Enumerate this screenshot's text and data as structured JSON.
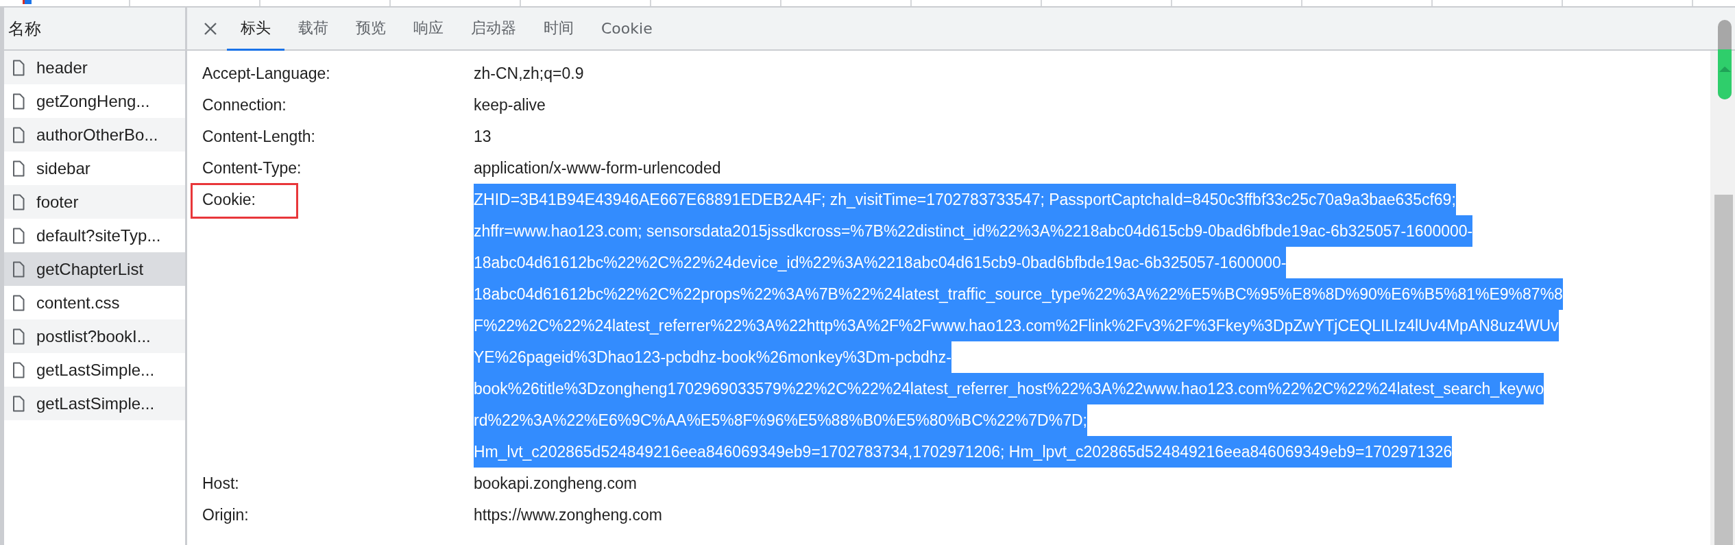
{
  "sidebar": {
    "title": "名称",
    "items": [
      {
        "label": "header",
        "selected": false
      },
      {
        "label": "getZongHeng...",
        "selected": false
      },
      {
        "label": "authorOtherBo...",
        "selected": false
      },
      {
        "label": "sidebar",
        "selected": false
      },
      {
        "label": "footer",
        "selected": false
      },
      {
        "label": "default?siteTyp...",
        "selected": false
      },
      {
        "label": "getChapterList",
        "selected": true
      },
      {
        "label": "content.css",
        "selected": false
      },
      {
        "label": "postlist?bookI...",
        "selected": false
      },
      {
        "label": "getLastSimple...",
        "selected": false
      },
      {
        "label": "getLastSimple...",
        "selected": false
      }
    ]
  },
  "tabs": [
    {
      "label": "标头",
      "selected": true
    },
    {
      "label": "载荷",
      "selected": false
    },
    {
      "label": "预览",
      "selected": false
    },
    {
      "label": "响应",
      "selected": false
    },
    {
      "label": "启动器",
      "selected": false
    },
    {
      "label": "时间",
      "selected": false
    },
    {
      "label": "Cookie",
      "selected": false
    }
  ],
  "headers": [
    {
      "name": "Accept-Language:",
      "value_lines": [
        "zh-CN,zh;q=0.9"
      ],
      "highlighted": false,
      "annotated": false
    },
    {
      "name": "Connection:",
      "value_lines": [
        "keep-alive"
      ],
      "highlighted": false,
      "annotated": false
    },
    {
      "name": "Content-Length:",
      "value_lines": [
        "13"
      ],
      "highlighted": false,
      "annotated": false
    },
    {
      "name": "Content-Type:",
      "value_lines": [
        "application/x-www-form-urlencoded"
      ],
      "highlighted": false,
      "annotated": false
    },
    {
      "name": "Cookie:",
      "value_lines": [
        "ZHID=3B41B94E43946AE667E68891EDEB2A4F; zh_visitTime=1702783733547; PassportCaptchaId=8450c3ffbf33c25c70a9a3bae635cf69;",
        "zhffr=www.hao123.com; sensorsdata2015jssdkcross=%7B%22distinct_id%22%3A%2218abc04d615cb9-0bad6bfbde19ac-6b325057-1600000-",
        "18abc04d61612bc%22%2C%22%24device_id%22%3A%2218abc04d615cb9-0bad6bfbde19ac-6b325057-1600000-",
        "18abc04d61612bc%22%2C%22props%22%3A%7B%22%24latest_traffic_source_type%22%3A%22%E5%BC%95%E8%8D%90%E6%B5%81%E9%87%8",
        "F%22%2C%22%24latest_referrer%22%3A%22http%3A%2F%2Fwww.hao123.com%2Flink%2Fv3%2F%3Fkey%3DpZwYTjCEQLILIz4lUv4MpAN8uz4WUv",
        "YE%26pageid%3Dhao123-pcbdhz-book%26monkey%3Dm-pcbdhz-",
        "book%26title%3Dzongheng1702969033579%22%2C%22%24latest_referrer_host%22%3A%22www.hao123.com%22%2C%22%24latest_search_keywo",
        "rd%22%3A%22%E6%9C%AA%E5%8F%96%E5%88%B0%E5%80%BC%22%7D%7D;",
        "Hm_lvt_c202865d524849216eea846069349eb9=1702783734,1702971206; Hm_lpvt_c202865d524849216eea846069349eb9=1702971326"
      ],
      "highlighted": true,
      "annotated": true
    },
    {
      "name": "Host:",
      "value_lines": [
        "bookapi.zongheng.com"
      ],
      "highlighted": false,
      "annotated": false
    },
    {
      "name": "Origin:",
      "value_lines": [
        "https://www.zongheng.com"
      ],
      "highlighted": false,
      "annotated": false
    }
  ]
}
